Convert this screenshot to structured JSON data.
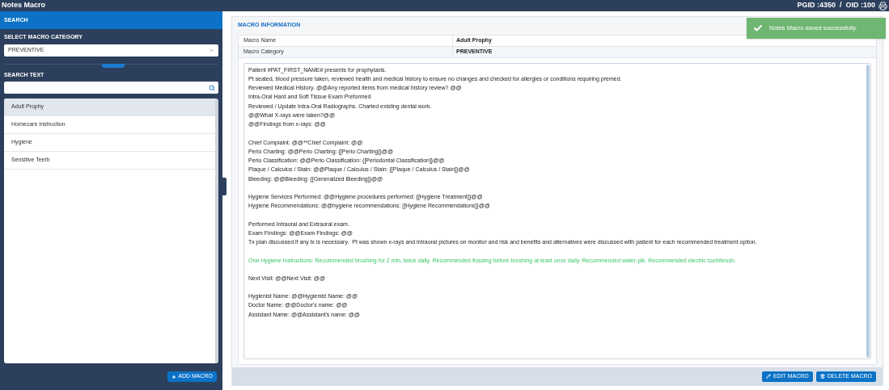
{
  "title": "Notes Macro",
  "ids": "PGID :4350  /  OID :100",
  "sidebar": {
    "header": "SEARCH",
    "category_label": "SELECT MACRO CATEGORY",
    "category_value": "PREVENTIVE",
    "search_label": "SEARCH TEXT",
    "items": [
      {
        "label": "Adult Prophy",
        "selected": true
      },
      {
        "label": "Homecare Instruction",
        "selected": false
      },
      {
        "label": "Hygiene",
        "selected": false
      },
      {
        "label": "Sensitive Teeth",
        "selected": false
      }
    ],
    "add_button": "ADD MACRO"
  },
  "toast": "Notes Macro saved successfully.",
  "macro": {
    "header": "MACRO INFORMATION",
    "fields": [
      {
        "label": "Macro Name",
        "value": "Adult Prophy"
      },
      {
        "label": "Macro Category",
        "value": "PREVENTIVE"
      }
    ],
    "paragraphs": [
      {
        "kind": "plain",
        "lines": [
          "Patient #PAT_FIRST_NAME# presents for prophylaxis.",
          "Pt seated, blood pressure taken, reviewed health and medical history to ensure no changes and checked for allergies or conditions requiring premed.",
          "Reviewed Medical History. @@Any reported items from medical history review? @@",
          "Intra-Oral Hard and Soft Tissue Exam Preformed",
          "Reviewed / Update Intra-Oral Radiographs. Charted existing dental work.",
          "@@What X-rays were taken?@@",
          "@@Findings from x-rays: @@"
        ]
      },
      {
        "kind": "plain",
        "lines": [
          "Chief Complaint: @@**Chief Complaint: @@",
          "Perio Charting: @@Perio Charting: {[Perio Charting]}@@",
          "Perio Classification: @@Perio Classification: {[Periodontal Classification]}@@",
          "Plaque / Calculus / Stain: @@Plaque / Calculus / Stain: {[Plaque / Calculus / Stain]}@@",
          "Bleeding: @@Bleeding: {[Generalized Bleeding]}@@"
        ]
      },
      {
        "kind": "plain",
        "lines": [
          "Hygiene Services Performed: @@Hygiene procedures performed: {[Hygiene Treatment]}@@",
          "Hygiene Recommendations: @@hygiene recommendations: {[Hygiene Recommendations]}@@"
        ]
      },
      {
        "kind": "plain",
        "lines": [
          "Performed Intraoral and Extraoral exam.",
          "Exam Findings: @@Exam Findings: @@",
          "Tx plan discussed if any tx is necessary.  Pt was shown x-rays and intraoral pictures on monitor and risk and benefits and alternatives were discussed with patient for each recommended treatment option."
        ]
      },
      {
        "kind": "instruction",
        "lines": [
          "Oral Hygiene Instructions: Recommended brushing for 2 min, twice daily. Recommended flossing before brushing at least once daily. Recommended water-pik. Recommended electric toothbrush."
        ]
      },
      {
        "kind": "plain",
        "lines": [
          "Next Visit: @@Next Visit: @@"
        ]
      },
      {
        "kind": "plain",
        "lines": [
          "Hygienist Name: @@Hygienist Name: @@",
          "Doctor Name: @@Doctor's name: @@",
          "Assistant Name: @@Assistant's name: @@"
        ]
      }
    ],
    "buttons": [
      {
        "kind": "edit",
        "label": "EDIT MACRO"
      },
      {
        "kind": "delete",
        "label": "DELETE MACRO"
      }
    ]
  }
}
